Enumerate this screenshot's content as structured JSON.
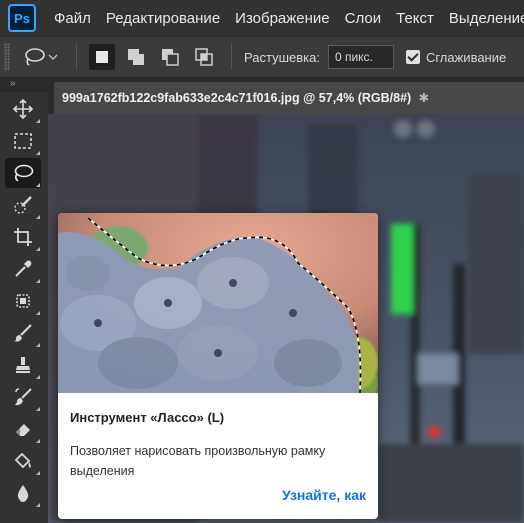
{
  "app": {
    "logo": "Ps"
  },
  "menu": [
    "Файл",
    "Редактирование",
    "Изображение",
    "Слои",
    "Текст",
    "Выделение"
  ],
  "options": {
    "feather_label": "Растушевка:",
    "feather_value": "0 пикс.",
    "antialias_label": "Сглаживание",
    "antialias_checked": true
  },
  "toolbar": {
    "collapse_glyph": "»",
    "tools": [
      "move-icon",
      "marquee-icon",
      "lasso-icon",
      "quick-selection-icon",
      "crop-icon",
      "eyedropper-icon",
      "patch-icon",
      "brush-icon",
      "stamp-icon",
      "history-brush-icon",
      "eraser-icon",
      "paint-bucket-icon",
      "blur-icon"
    ],
    "active_tool": "lasso-icon"
  },
  "document": {
    "tab_title": "999a1762fb122c9fab633e2c4c71f016.jpg @ 57,4% (RGB/8#)",
    "close_glyph": "✱"
  },
  "tooltip": {
    "title": "Инструмент «Лассо» (L)",
    "description": "Позволяет нарисовать произвольную рамку выделения",
    "link": "Узнайте, как"
  },
  "colors": {
    "accent": "#31a8ff",
    "link": "#1473e6",
    "chrome": "#323232"
  }
}
